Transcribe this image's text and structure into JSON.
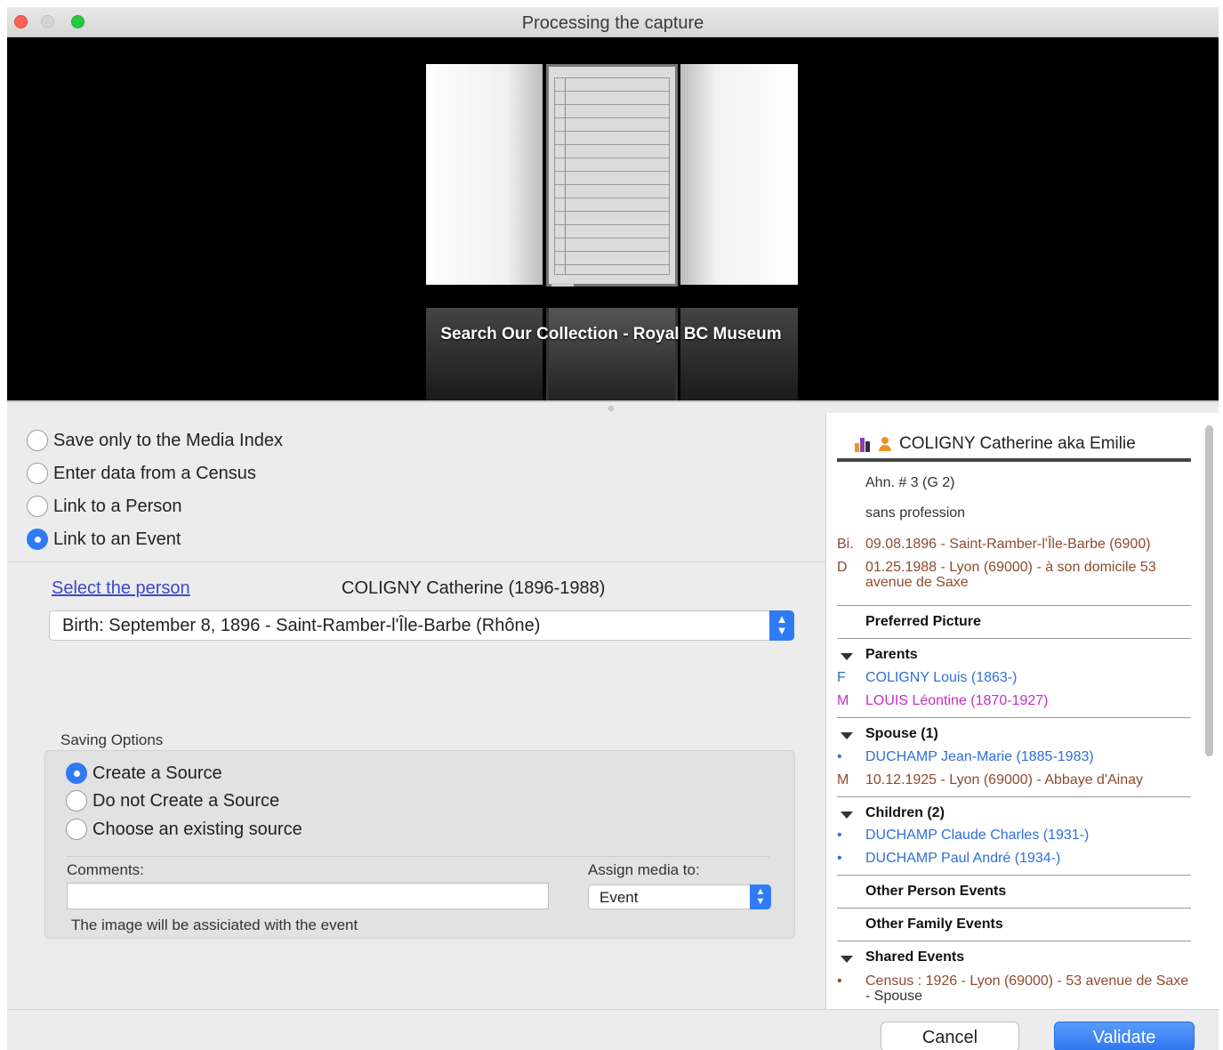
{
  "window": {
    "title": "Processing the capture"
  },
  "preview": {
    "caption": "Search Our Collection - Royal BC Museum"
  },
  "options": [
    {
      "label": "Save only to the Media Index",
      "selected": false
    },
    {
      "label": "Enter data from a Census",
      "selected": false
    },
    {
      "label": "Link to a Person",
      "selected": false
    },
    {
      "label": "Link to an Event",
      "selected": true
    }
  ],
  "person": {
    "select_link": "Select the person",
    "name": "COLIGNY Catherine (1896-1988)",
    "event_value": "Birth: September 8, 1896 - Saint-Ramber-l'Île-Barbe (Rhône)"
  },
  "saving": {
    "title": "Saving Options",
    "options": [
      {
        "label": "Create a Source",
        "selected": true
      },
      {
        "label": "Do not Create a Source",
        "selected": false
      },
      {
        "label": "Choose an existing source",
        "selected": false
      }
    ],
    "comments_label": "Comments:",
    "comments_value": "",
    "note": "The image will be assiciated with the event",
    "assign_label": "Assign media to:",
    "assign_value": "Event"
  },
  "right_panel": {
    "header": "COLIGNY Catherine aka Emilie",
    "ahn": "Ahn. # 3 (G 2)",
    "profession": "sans profession",
    "birth_marker": "Bi.",
    "birth": "09.08.1896 - Saint-Ramber-l'Île-Barbe (6900)",
    "death_marker": "D",
    "death": "01.25.1988 - Lyon (69000) - à son domicile 53 avenue de Saxe",
    "preferred_picture": "Preferred Picture",
    "parents_title": "Parents",
    "father_marker": "F",
    "father": "COLIGNY Louis (1863-)",
    "mother_marker": "M",
    "mother": "LOUIS Léontine (1870-1927)",
    "spouse_title": "Spouse (1)",
    "spouse_marker": "•",
    "spouse": "DUCHAMP Jean-Marie (1885-1983)",
    "marriage_marker": "M",
    "marriage": "10.12.1925 - Lyon (69000) - Abbaye d'Ainay",
    "children_title": "Children (2)",
    "children": [
      {
        "marker": "•",
        "name": "DUCHAMP Claude Charles (1931-)"
      },
      {
        "marker": "•",
        "name": "DUCHAMP Paul André (1934-)"
      }
    ],
    "other_person_events": "Other Person Events",
    "other_family_events": "Other Family Events",
    "shared_events_title": "Shared Events",
    "shared_marker": "•",
    "shared_event": "Census : 1926 - Lyon (69000) - 53 avenue de Saxe",
    "shared_event_role": " - Spouse"
  },
  "buttons": {
    "cancel": "Cancel",
    "validate": "Validate"
  },
  "colors": {
    "accent": "#2f7bf5",
    "link_blue": "#2f6fd6",
    "event_brown": "#8f4a2f",
    "mother_magenta": "#c330c3"
  }
}
